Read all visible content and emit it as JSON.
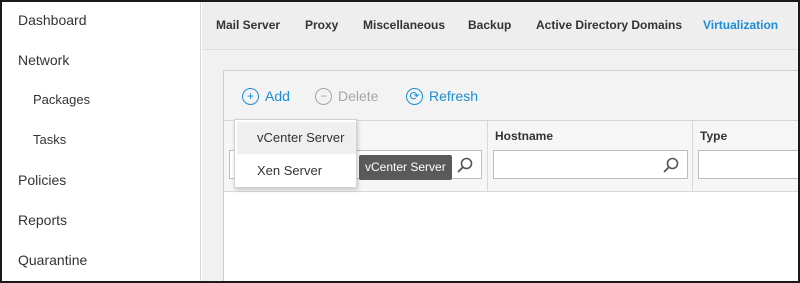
{
  "sidebar": {
    "items": [
      {
        "label": "Dashboard"
      },
      {
        "label": "Network"
      },
      {
        "label": "Packages"
      },
      {
        "label": "Tasks"
      },
      {
        "label": "Policies"
      },
      {
        "label": "Reports"
      },
      {
        "label": "Quarantine"
      }
    ]
  },
  "tabs": [
    {
      "label": "Mail Server"
    },
    {
      "label": "Proxy"
    },
    {
      "label": "Miscellaneous"
    },
    {
      "label": "Backup"
    },
    {
      "label": "Active Directory Domains"
    },
    {
      "label": "Virtualization",
      "active": true
    }
  ],
  "toolbar": {
    "add_label": "Add",
    "delete_label": "Delete",
    "refresh_label": "Refresh"
  },
  "grid": {
    "columns": [
      {
        "title": "",
        "filter_value": ""
      },
      {
        "title": "Hostname",
        "filter_value": ""
      },
      {
        "title": "Type",
        "filter_value": ""
      }
    ],
    "selected_chip": "vCenter Server"
  },
  "dropdown": {
    "options": [
      "vCenter Server",
      "Xen Server"
    ],
    "highlighted": "vCenter Server"
  },
  "colors": {
    "accent": "#1b8ed6",
    "disabled": "#a6a6a6",
    "chip_bg": "#5a5a5a"
  }
}
